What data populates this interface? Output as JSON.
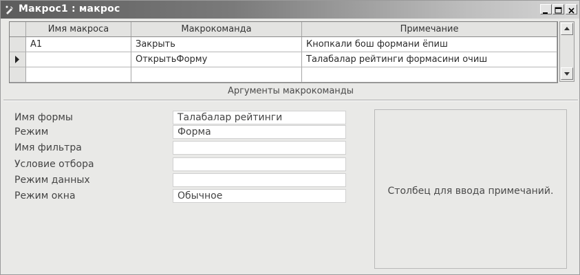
{
  "window": {
    "title": "Макрос1 : макрос",
    "controls": {
      "minimize_icon": "minimize-icon",
      "maximize_icon": "maximize-icon",
      "close_icon": "close-icon"
    }
  },
  "grid": {
    "columns": [
      "Имя макроса",
      "Макрокоманда",
      "Примечание"
    ],
    "rows": [
      {
        "name": "А1",
        "action": "Закрыть",
        "note": "Кнопкали бош формани ёпиш",
        "current": false
      },
      {
        "name": "",
        "action": "ОткрытьФорму",
        "note": "Талабалар рейтинги  формасини очиш",
        "current": true
      }
    ]
  },
  "arguments": {
    "title": "Аргументы макрокоманды",
    "items": [
      {
        "label": "Имя формы",
        "value": "Талабалар рейтинги"
      },
      {
        "label": "Режим",
        "value": "Форма"
      },
      {
        "label": "Имя фильтра",
        "value": ""
      },
      {
        "label": "Условие отбора",
        "value": ""
      },
      {
        "label": "Режим данных",
        "value": ""
      },
      {
        "label": "Режим окна",
        "value": "Обычное"
      }
    ],
    "hint": "Столбец для ввода примечаний."
  }
}
